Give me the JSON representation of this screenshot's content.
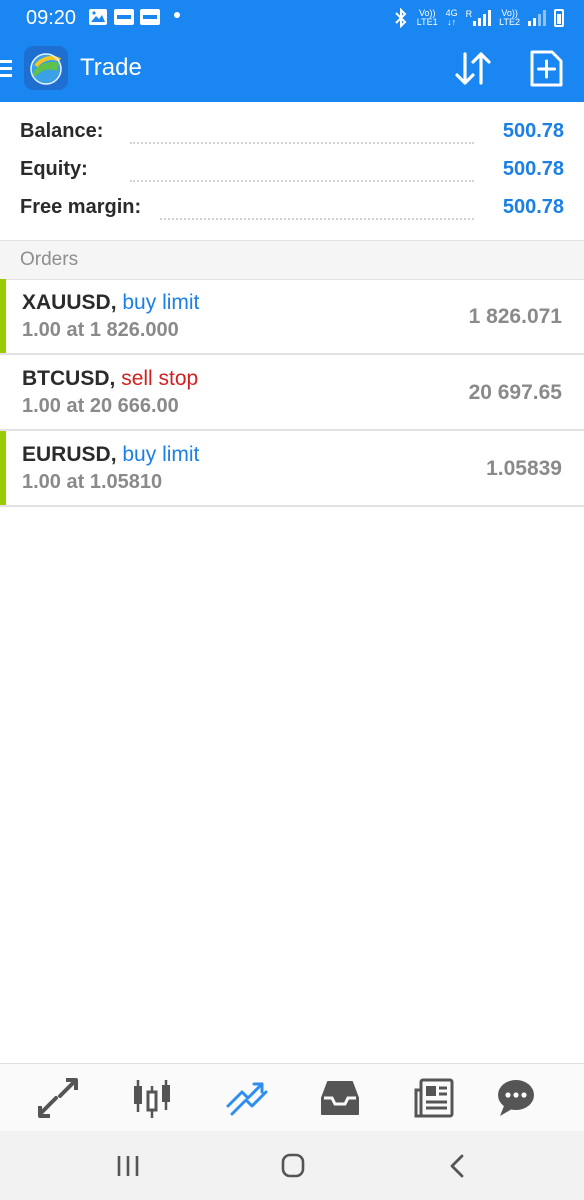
{
  "status_bar": {
    "time": "09:20",
    "net1_top": "Vo))",
    "net1_bottom": "LTE1",
    "net_mid_top": "4G",
    "net_mid_bottom": "↓↑",
    "net_r": "R",
    "net2_top": "Vo))",
    "net2_bottom": "LTE2"
  },
  "app_bar": {
    "title": "Trade",
    "icons": [
      "menu-icon",
      "app-logo",
      "sort-icon",
      "new-order-icon"
    ]
  },
  "account": {
    "balance_label": "Balance:",
    "balance_value": "500.78",
    "equity_label": "Equity:",
    "equity_value": "500.78",
    "free_margin_label": "Free margin:",
    "free_margin_value": "500.78"
  },
  "orders_header": "Orders",
  "orders": [
    {
      "symbol": "XAUUSD",
      "sep": ",",
      "type": "buy limit",
      "detail": "1.00 at 1 826.000",
      "price": "1 826.071"
    },
    {
      "symbol": "BTCUSD",
      "sep": ",",
      "type": "sell stop",
      "detail": "1.00 at 20 666.00",
      "price": "20 697.65"
    },
    {
      "symbol": "EURUSD",
      "sep": ",",
      "type": "buy limit",
      "detail": "1.00 at 1.05810",
      "price": "1.05839"
    }
  ],
  "colors": {
    "app_bar": "#1a86f1",
    "value_blue": "#1a80e5",
    "buy": "#1a80e5",
    "sell": "#d32020",
    "buy_marker": "#99cc00",
    "active_tab": "#2f8ff0"
  },
  "tab_bar": [
    "quotes-icon",
    "chart-icon",
    "trade-icon",
    "history-icon",
    "news-icon",
    "chat-icon"
  ],
  "active_tab": "trade-icon",
  "system_nav": [
    "recents-icon",
    "home-icon",
    "back-icon"
  ]
}
